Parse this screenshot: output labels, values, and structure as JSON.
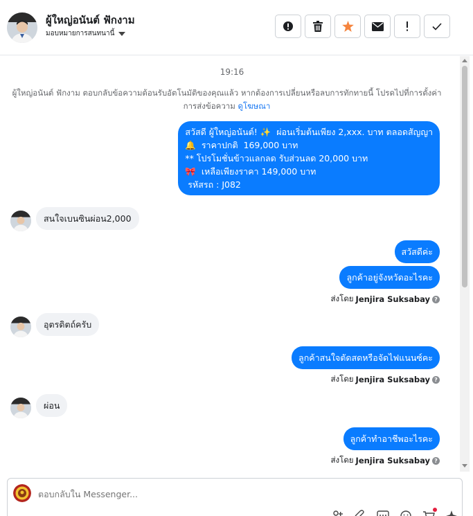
{
  "header": {
    "contact_name": "ผู้ใหญ่อนันต์ ฟักงาม",
    "assign_label": "มอบหมายการสนทนานี้"
  },
  "actions": [
    {
      "name": "alert-circle-button",
      "icon": "exclamation-circle-icon"
    },
    {
      "name": "delete-button",
      "icon": "trash-icon"
    },
    {
      "name": "star-button",
      "icon": "star-icon",
      "color": "#f5853f"
    },
    {
      "name": "mail-button",
      "icon": "envelope-icon"
    },
    {
      "name": "important-button",
      "icon": "exclamation-icon"
    },
    {
      "name": "done-button",
      "icon": "check-icon"
    }
  ],
  "thread": {
    "timestamp": "19:16",
    "notice_text": "ผู้ใหญ่อนันต์ ฟักงาม ตอบกลับข้อความต้อนรับอัตโนมัติของคุณแล้ว หากต้องการเปลี่ยนหรือลบการทักทายนี้ โปรดไปที่การตั้งค่าการส่งข้อความ",
    "notice_link": "ดูโฆษณา",
    "messages": {
      "m1": "สวัสดี ผู้ใหญ่อนันต์! ✨  ผ่อนเริ่มต้นเพียง 2,xxx. บาท ตลอดสัญญา\n🔔  ราคาปกติ  169,000 บาท\n** โปรโมชั่นข้าวแลกลด รับส่วนลด 20,000 บาท\n🎀  เหลือเพียงราคา 149,000 บาท\n รหัสรถ : J082",
      "m2": "สนใจเบนซินผ่อน2,000",
      "m3": "สวัสดีค่ะ",
      "m4": "ลูกค้าอยู่จังหวัดอะไรคะ",
      "m5": "อุตรดิตถ์ครับ",
      "m6": "ลูกค้าสนใจตัดสดหรือจัดไฟแนนซ์คะ",
      "m7": "ผ่อน",
      "m8": "ลูกค้าทำอาชีพอะไรคะ"
    },
    "sent_by_prefix": "ส่งโดย",
    "sent_by_name": "Jenjira Suksabay"
  },
  "composer": {
    "placeholder": "ตอบกลับใน Messenger..."
  },
  "colors": {
    "accent": "#0a7cff",
    "incoming_bubble": "#f0f2f5",
    "star": "#f5853f"
  }
}
